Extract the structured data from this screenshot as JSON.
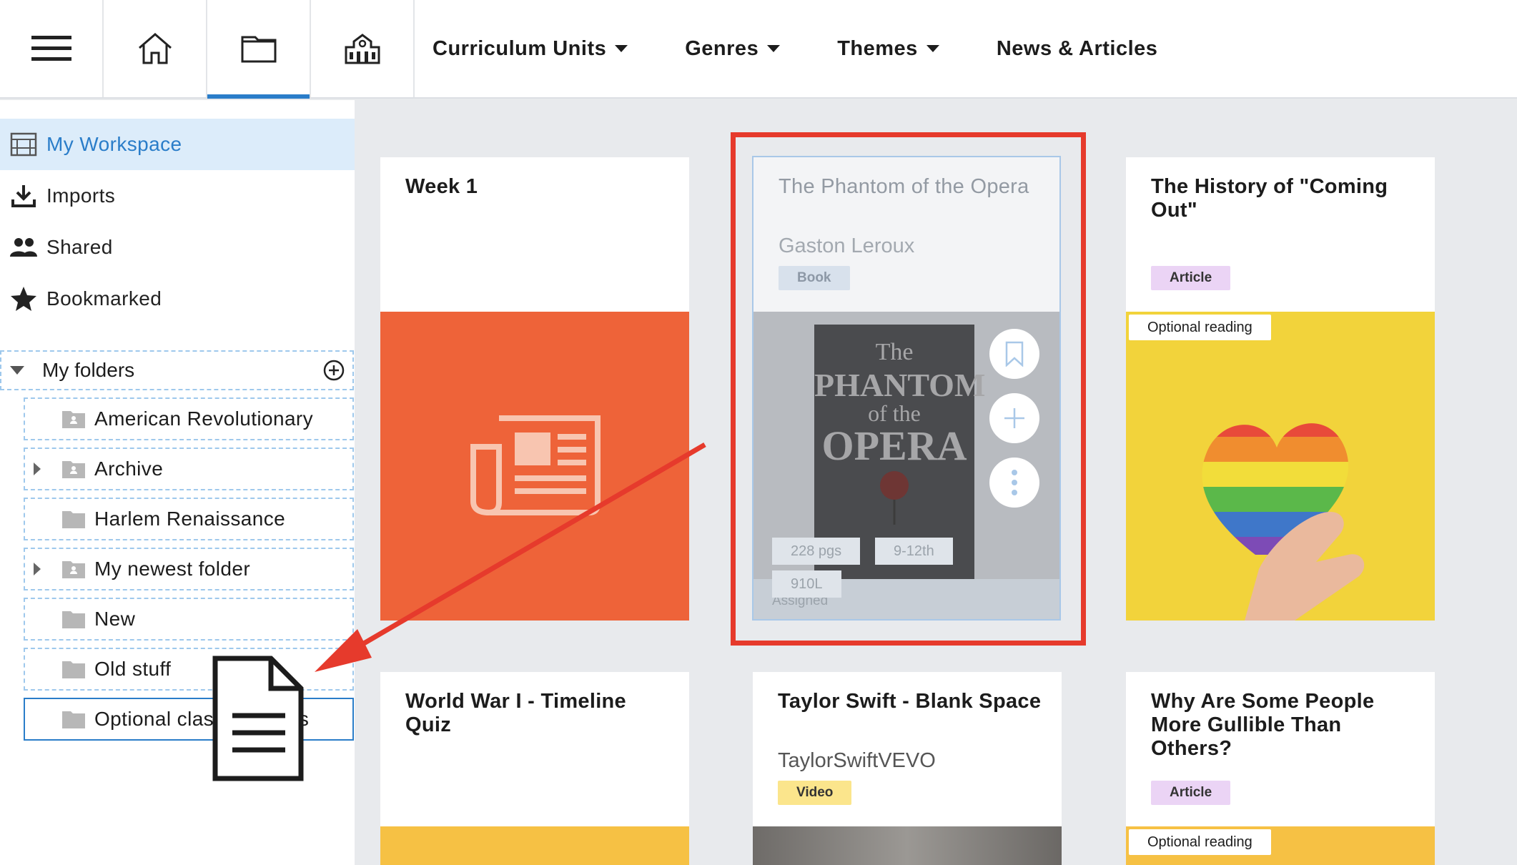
{
  "topnav": {
    "menu_items": [
      {
        "label": "Curriculum Units",
        "dropdown": true
      },
      {
        "label": "Genres",
        "dropdown": true
      },
      {
        "label": "Themes",
        "dropdown": true
      },
      {
        "label": "News & Articles",
        "dropdown": false
      }
    ],
    "icons": [
      "hamburger-icon",
      "home-icon",
      "folder-icon",
      "school-icon"
    ],
    "active_icon": "folder-icon",
    "accent_color": "#2a7dc9"
  },
  "sidebar": {
    "items": [
      {
        "label": "My Workspace",
        "icon": "workspace-icon",
        "active": true
      },
      {
        "label": "Imports",
        "icon": "download-icon"
      },
      {
        "label": "Shared",
        "icon": "people-icon"
      },
      {
        "label": "Bookmarked",
        "icon": "star-icon"
      }
    ],
    "folders_heading": "My folders",
    "folders": [
      {
        "label": "American Revolutionary",
        "shared": true,
        "expandable": false
      },
      {
        "label": "Archive",
        "shared": true,
        "expandable": true
      },
      {
        "label": "Harlem Renaissance",
        "shared": false,
        "expandable": false
      },
      {
        "label": "My newest folder",
        "shared": true,
        "expandable": true
      },
      {
        "label": "New",
        "shared": false,
        "expandable": false
      },
      {
        "label": "Old stuff",
        "shared": false,
        "expandable": false
      },
      {
        "label": "Optional class readings",
        "shared": false,
        "expandable": false,
        "selected": true
      }
    ]
  },
  "cards": {
    "week1": {
      "title": "Week 1",
      "color": "#ee6339"
    },
    "phantom": {
      "title": "The Phantom of the Opera",
      "author": "Gaston Leroux",
      "tag": "Book",
      "cover_line1": "The",
      "cover_line2": "PHANTOM",
      "cover_line3": "of the",
      "cover_line4": "OPERA",
      "pages": "228 pgs",
      "grades": "9-12th",
      "lexile": "910L",
      "status": "Assigned"
    },
    "history": {
      "title": "The History of \"Coming Out\"",
      "tag": "Article",
      "badge": "Optional reading",
      "color": "#f2d33b"
    },
    "wwi": {
      "title": "World War I - Timeline Quiz",
      "color": "#f6c144"
    },
    "taylor": {
      "title": "Taylor Swift - Blank Space",
      "author": "TaylorSwiftVEVO",
      "tag": "Video"
    },
    "gullible": {
      "title": "Why Are Some People More Gullible Than Others?",
      "tag": "Article",
      "badge": "Optional reading",
      "color": "#f6c144"
    }
  },
  "annotation_color": "#e63a2c"
}
